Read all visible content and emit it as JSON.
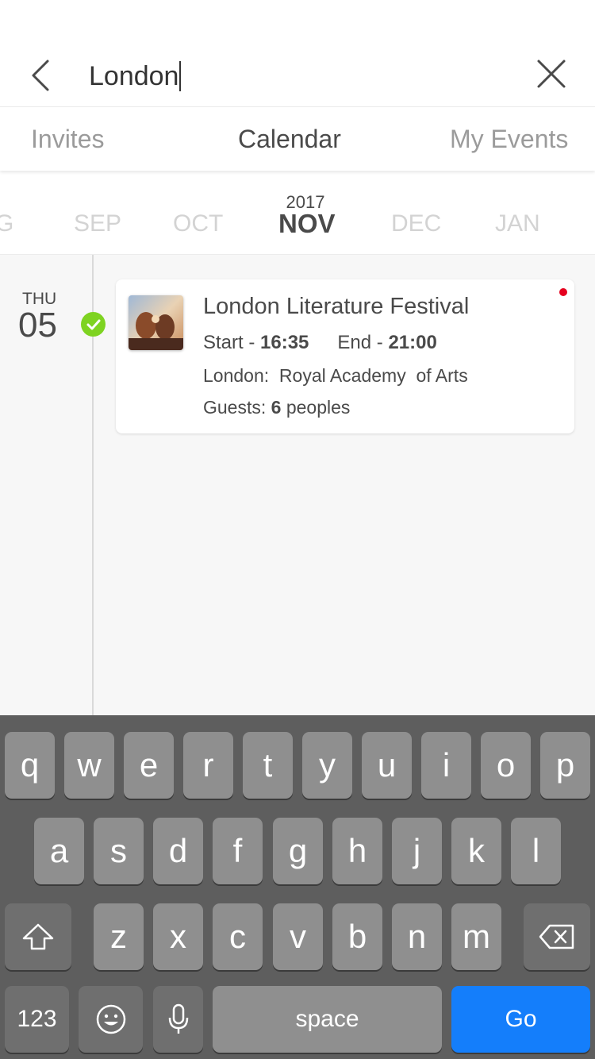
{
  "search": {
    "value": "London"
  },
  "tabs": [
    {
      "label": "Invites",
      "active": false
    },
    {
      "label": "Calendar",
      "active": true
    },
    {
      "label": "My Events",
      "active": false
    }
  ],
  "months": {
    "year": "2017",
    "items": [
      "G",
      "SEP",
      "OCT",
      "NOV",
      "DEC",
      "JAN"
    ],
    "selected": "NOV"
  },
  "day": {
    "weekday": "THU",
    "number": "05",
    "status_color": "#7ed321"
  },
  "event": {
    "title": "London Literature Festival",
    "start_label": "Start - ",
    "start_time": "16:35",
    "end_label": "End - ",
    "end_time": "21:00",
    "location": "London:  Royal Academy  of Arts",
    "guests_label": "Guests: ",
    "guests_count": "6",
    "guests_unit": " peoples",
    "unread_dot_color": "#e5001f"
  },
  "keyboard": {
    "row1": [
      "q",
      "w",
      "e",
      "r",
      "t",
      "y",
      "u",
      "i",
      "o",
      "p"
    ],
    "row2": [
      "a",
      "s",
      "d",
      "f",
      "g",
      "h",
      "j",
      "k",
      "l"
    ],
    "row3": [
      "z",
      "x",
      "c",
      "v",
      "b",
      "n",
      "m"
    ],
    "numbers_label": "123",
    "space_label": "space",
    "go_label": "Go",
    "go_color": "#147efb"
  }
}
